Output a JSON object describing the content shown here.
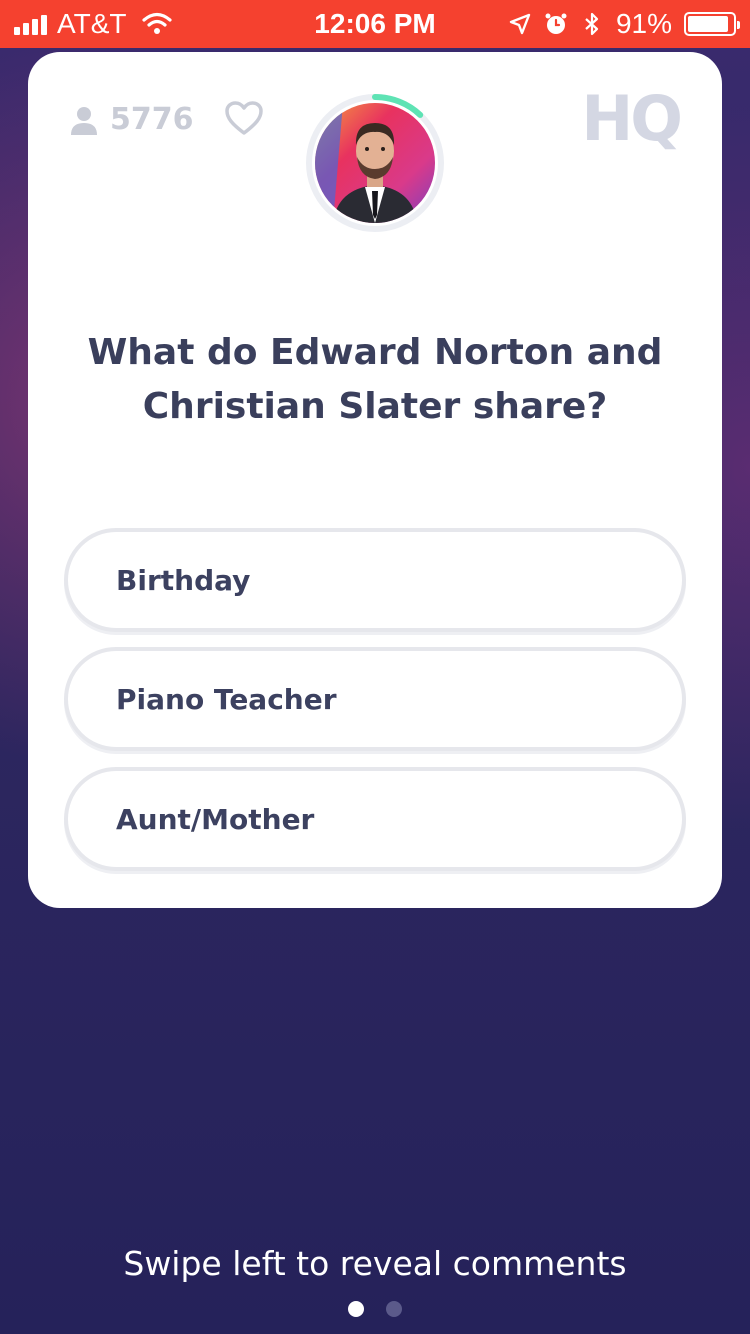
{
  "status_bar": {
    "carrier": "AT&T",
    "time": "12:06 PM",
    "battery_text": "91%",
    "battery_level": 0.91,
    "background_color": "#f5412f",
    "icons": [
      "signal-icon",
      "wifi-icon",
      "location-icon",
      "alarm-icon",
      "bluetooth-icon",
      "battery-icon"
    ]
  },
  "game": {
    "player_count": "5776",
    "logo": "HQ",
    "timer_remaining_fraction": 0.12,
    "timer_color": "#5ee3b4",
    "question": "What do Edward Norton and Christian Slater share?",
    "answers": [
      {
        "label": "Birthday"
      },
      {
        "label": "Piano Teacher"
      },
      {
        "label": "Aunt/Mother"
      }
    ]
  },
  "footer": {
    "swipe_hint": "Swipe left to reveal comments",
    "page_count": 2,
    "active_page": 1
  }
}
